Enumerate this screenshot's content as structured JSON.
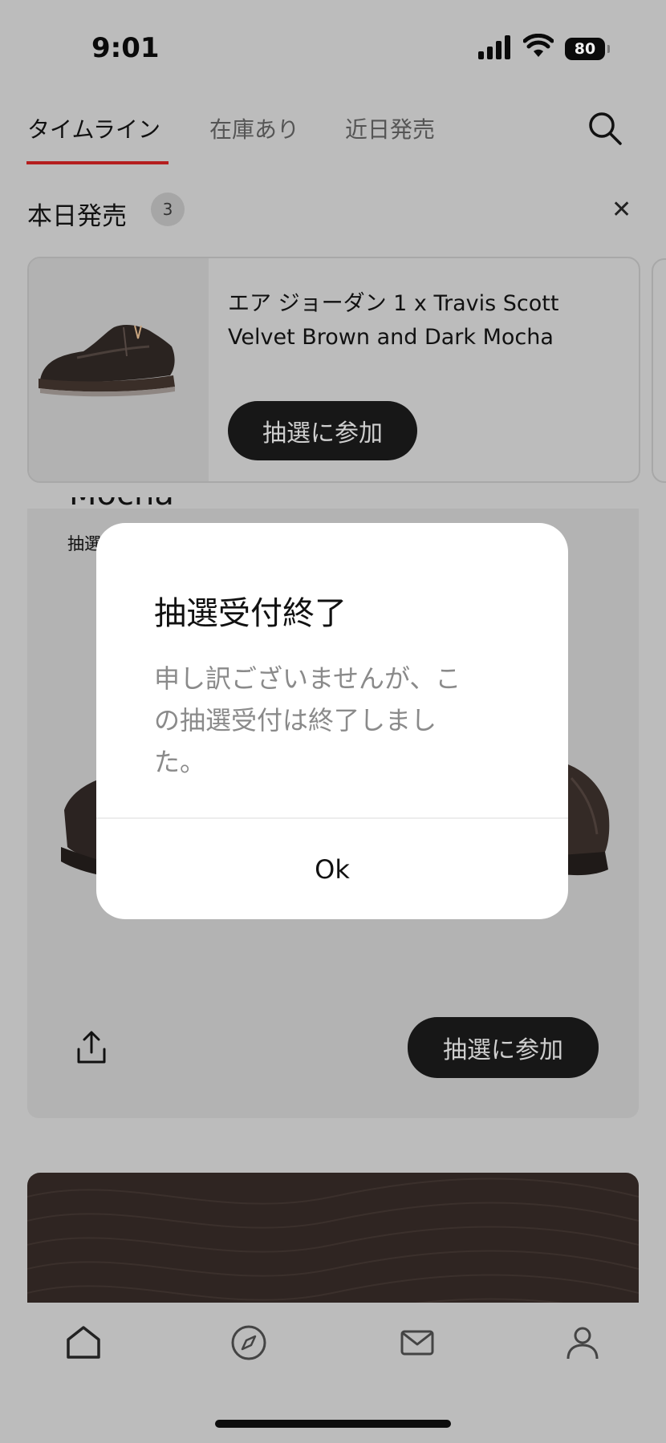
{
  "status_bar": {
    "time": "9:01",
    "battery": "80"
  },
  "tabs": [
    {
      "label": "タイムライン",
      "active": true
    },
    {
      "label": "在庫あり",
      "active": false
    },
    {
      "label": "近日発売",
      "active": false
    }
  ],
  "section": {
    "title": "本日発売",
    "count": "3"
  },
  "product_card": {
    "name_line1": "エア ジョーダン 1 x Travis Scott",
    "name_line2": "Velvet Brown and Dark Mocha",
    "button": "抽選に参加"
  },
  "feature_card": {
    "title_fragment": "Mocha",
    "subtitle_fragment": "抽選",
    "button": "抽選に参加"
  },
  "dialog": {
    "title": "抽選受付終了",
    "message_line1": "申し訳ございませんが、こ",
    "message_line2": "の抽選受付は終了しまし",
    "message_line3": "た。",
    "ok": "Ok"
  },
  "nav": {
    "items": [
      "home-icon",
      "compass-icon",
      "mail-icon",
      "profile-icon"
    ]
  },
  "colors": {
    "accent": "#b41e1e",
    "button_bg": "#171717",
    "overlay": "#bcbcbc",
    "dialog_bg": "#ffffff"
  }
}
